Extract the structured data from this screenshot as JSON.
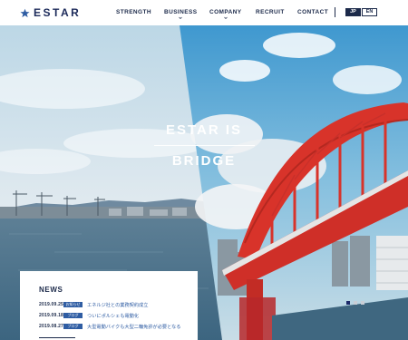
{
  "brand": {
    "name": "ESTAR",
    "logo_icon": "star-icon",
    "color": "#1c2a5a"
  },
  "nav": {
    "items": [
      {
        "label": "STRENGTH",
        "has_dropdown": false
      },
      {
        "label": "BUSINESS",
        "has_dropdown": true
      },
      {
        "label": "COMPANY",
        "has_dropdown": true
      },
      {
        "label": "RECRUIT",
        "has_dropdown": false
      },
      {
        "label": "CONTACT",
        "has_dropdown": false
      }
    ],
    "languages": [
      {
        "label": "JP",
        "active": true
      },
      {
        "label": "EN",
        "active": false
      }
    ]
  },
  "hero": {
    "line1": "ESTAR IS",
    "line2": "BRIDGE",
    "slides_total": 3,
    "slide_active": 1
  },
  "news": {
    "title": "NEWS",
    "items": [
      {
        "date": "2019.09.25",
        "tag": "お知らせ",
        "text": "エネルジ社との業務契約成立"
      },
      {
        "date": "2019.09.18",
        "tag": "ブログ",
        "text": "ついにポルシェも電動化"
      },
      {
        "date": "2019.08.27",
        "tag": "ブログ",
        "text": "大型電動バイクも大型二輪免許が必要となる"
      }
    ]
  },
  "colors": {
    "accent": "#2f5da3",
    "navy": "#1c2a4a",
    "bridge": "#d8332a"
  }
}
